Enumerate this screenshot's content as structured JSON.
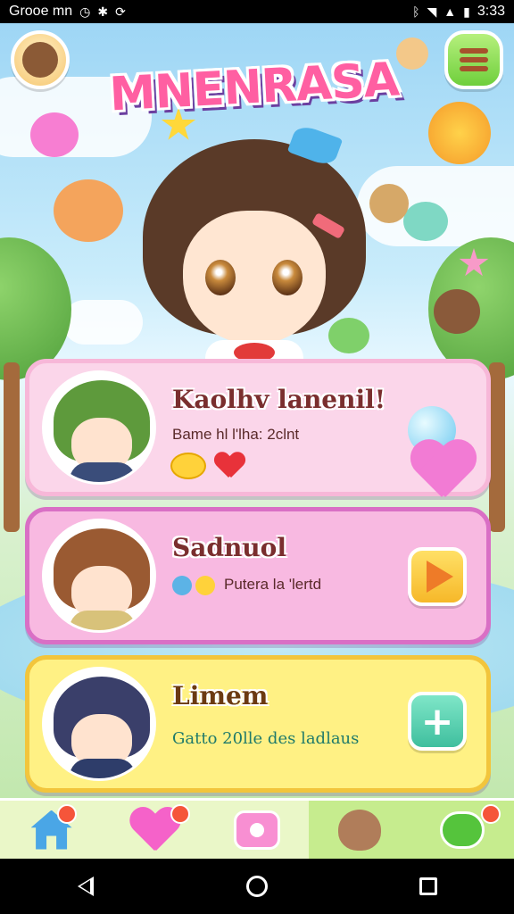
{
  "status_bar": {
    "left_text": "Grooe mn",
    "left_icons": [
      "clock-icon",
      "settings-icon",
      "sync-icon"
    ],
    "right_icons": [
      "bluetooth-icon",
      "wifi-icon",
      "signal-icon",
      "battery-icon"
    ],
    "time": "3:33"
  },
  "header": {
    "logo_text": "MNENRASA",
    "avatar_icon": "profile-avatar-icon",
    "menu_icon": "hamburger-menu-icon"
  },
  "cards": [
    {
      "title": "Kaolhv lanenil!",
      "subtitle": "Bame hl l'lha: 2clnt",
      "icons": [
        "smiley-face-icon",
        "heart-icon"
      ],
      "right_icons": [
        "blue-balloon-icon",
        "heart-balloon-icon"
      ],
      "accent": "#fbd6ea"
    },
    {
      "title": "Sadnuol",
      "subtitle": "Putera la 'lertd",
      "icons": [
        "sparkle-icon"
      ],
      "action_icon": "play-icon",
      "accent": "#f8b9e1"
    },
    {
      "title": "Limem",
      "subtitle": "Gatto 20lle des ladlaus",
      "action_icon": "plus-icon",
      "action_symbol": "+",
      "accent": "#fff184"
    }
  ],
  "tab_bar": {
    "tabs": [
      {
        "icon": "home-icon",
        "badge": true
      },
      {
        "icon": "heart-icon",
        "badge": true
      },
      {
        "icon": "camera-icon",
        "badge": false
      },
      {
        "icon": "pet-icon",
        "badge": false
      },
      {
        "icon": "chat-icon",
        "badge": true
      }
    ]
  },
  "nav_bar": {
    "buttons": [
      "back-icon",
      "home-circle-icon",
      "recents-icon"
    ]
  },
  "colors": {
    "brand_pink": "#ff5fa2",
    "menu_green": "#6fcf3c",
    "badge_red": "#f5553a"
  }
}
